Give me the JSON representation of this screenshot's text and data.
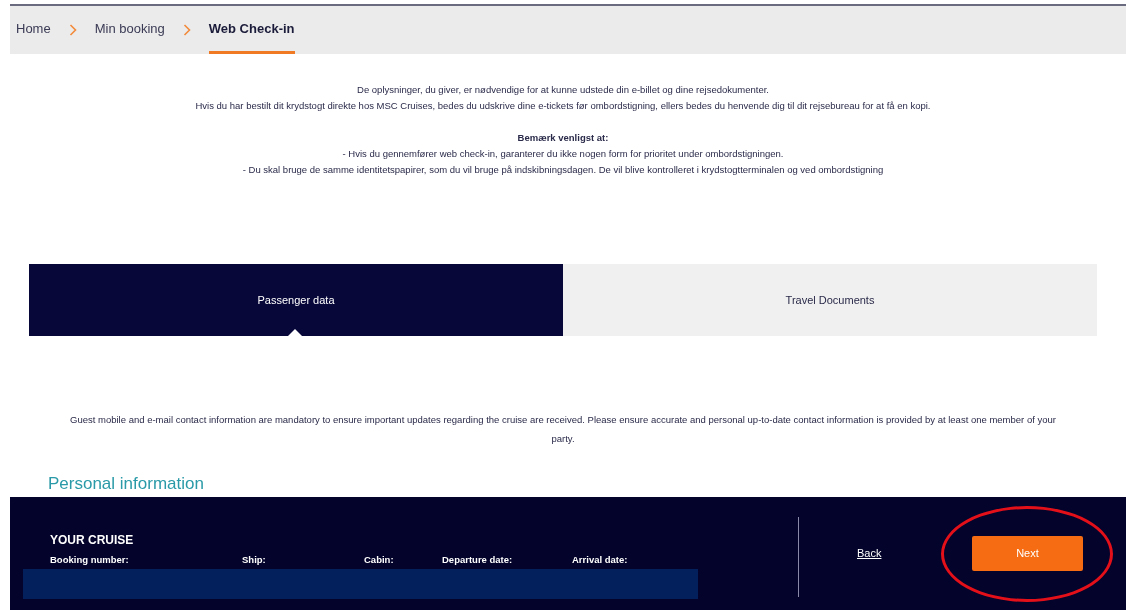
{
  "breadcrumb": [
    {
      "label": "Home",
      "selected": false
    },
    {
      "label": "Min booking",
      "selected": false
    },
    {
      "label": "Web Check-in",
      "selected": true
    }
  ],
  "intro": {
    "lines": [
      "De oplysninger, du giver, er nødvendige for at kunne udstede din e-billet og dine rejsedokumenter.",
      "Hvis du har bestilt dit krydstogt direkte hos MSC Cruises, bedes du udskrive dine e-tickets før ombordstigning, ellers bedes du henvende dig til dit rejsebureau for at få en kopi."
    ],
    "note_title": "Bemærk venligst at:",
    "notes": [
      "- Hvis du gennemfører web check-in, garanterer du ikke nogen form for prioritet under ombordstigningen.",
      "- Du skal bruge de samme identitetspapirer, som du vil bruge på indskibningsdagen. De vil blive kontrolleret i krydstogtterminalen og ved ombordstigning"
    ]
  },
  "tabs": [
    {
      "label": "Passenger data",
      "selected": true
    },
    {
      "label": "Travel Documents",
      "selected": false
    }
  ],
  "contact_notice": "Guest mobile and e-mail contact information are mandatory to ensure important updates regarding the cruise are received. Please ensure accurate and personal up-to-date contact information is provided by at least one member of your party.",
  "section_title": "Personal information",
  "footer": {
    "title": "YOUR CRUISE",
    "columns": [
      "Booking number:",
      "Ship:",
      "Cabin:",
      "Departure date:",
      "Arrival date:"
    ],
    "back": "Back",
    "next": "Next"
  }
}
